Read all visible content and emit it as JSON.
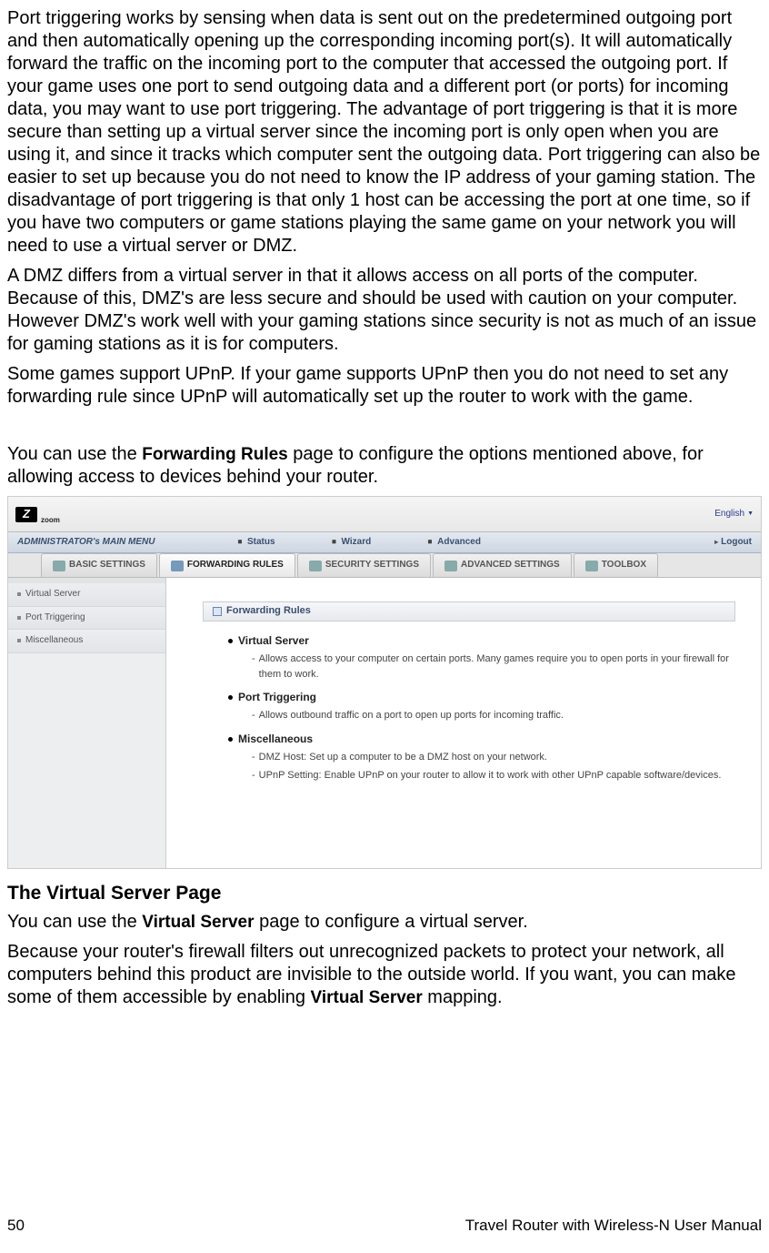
{
  "paragraphs": {
    "p1": "Port triggering works by sensing when data is sent out on the predetermined outgoing port and then automatically opening up the corresponding incoming port(s). It will automatically forward the traffic on the incoming port to the computer that accessed the outgoing port. If your game uses one port to send outgoing data and a different port (or ports) for incoming data, you may want to use port triggering. The advantage of port triggering is that it is more secure than setting up a virtual server since the incoming port is only open when you are using it, and since it tracks which computer sent the outgoing data. Port triggering can also be easier to set up because you do not need to know the IP address of your gaming station. The disadvantage of port triggering is that only 1 host can be accessing the port at one time, so if you have two computers or game stations playing the same game on your network you will need to use a virtual server or DMZ.",
    "p2": "A DMZ differs from a virtual server in that it allows access on all ports of the computer. Because of this, DMZ's are less secure and should be used with caution on your computer. However DMZ's work well with your gaming stations since security is not as much of an issue for gaming stations as it is for computers.",
    "p3": "Some games support UPnP. If your game supports UPnP then you do not need to set any forwarding rule since UPnP will automatically set up the router to work with the game.",
    "p4_a": "You can use the ",
    "p4_bold": "Forwarding Rules",
    "p4_b": " page to configure the options mentioned above, for allowing access to devices behind your router.",
    "heading_vs": "The Virtual Server Page",
    "p5_a": "You can use the ",
    "p5_bold": "Virtual Server",
    "p5_b": " page to configure a virtual server.",
    "p6_a": "Because your router's firewall filters out unrecognized packets to protect your network, all computers behind this product are invisible to the outside world. If you want, you can make some of them accessible by enabling ",
    "p6_bold": "Virtual Server",
    "p6_b": " mapping."
  },
  "screenshot": {
    "logo": "zoom",
    "lang": "English",
    "menu_title": "ADMINISTRATOR's MAIN MENU",
    "menu_items": [
      "Status",
      "Wizard",
      "Advanced",
      "Logout"
    ],
    "tabs": [
      "BASIC SETTINGS",
      "FORWARDING RULES",
      "SECURITY SETTINGS",
      "ADVANCED SETTINGS",
      "TOOLBOX"
    ],
    "active_tab": 1,
    "sidebar": [
      "Virtual Server",
      "Port Triggering",
      "Miscellaneous"
    ],
    "panel_title": "Forwarding Rules",
    "rules": [
      {
        "title": "Virtual Server",
        "desc": [
          "Allows access to your computer on certain ports. Many games require you to open ports in your firewall for them to work."
        ]
      },
      {
        "title": "Port Triggering",
        "desc": [
          "Allows outbound traffic on a port to open up ports for incoming traffic."
        ]
      },
      {
        "title": "Miscellaneous",
        "desc": [
          "DMZ Host: Set up a computer to be a DMZ host on your network.",
          "UPnP Setting: Enable UPnP on your router to allow it to work with other UPnP capable software/devices."
        ]
      }
    ]
  },
  "footer": {
    "page": "50",
    "doc": "Travel Router with Wireless-N User Manual"
  }
}
